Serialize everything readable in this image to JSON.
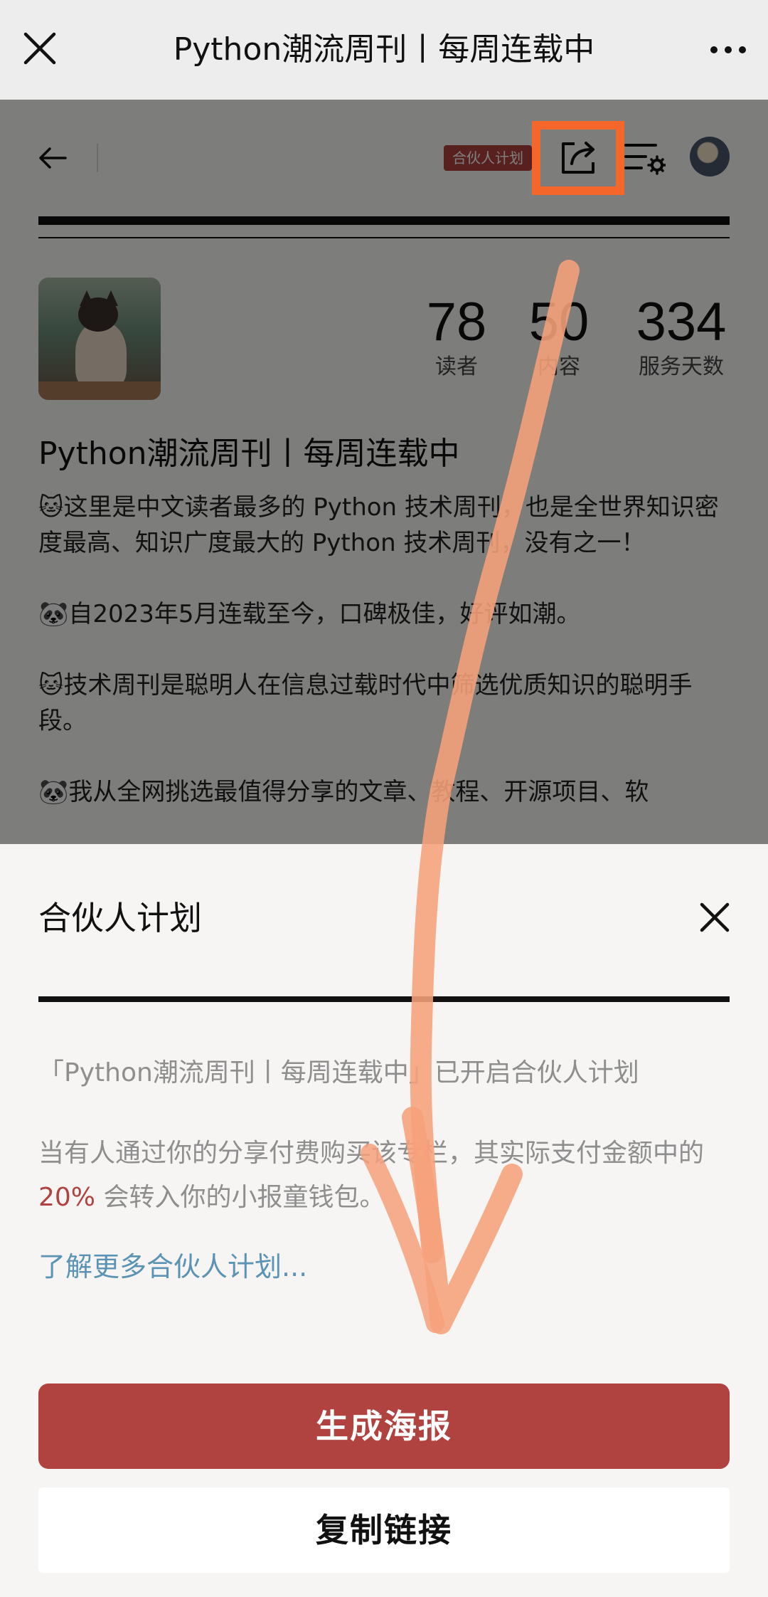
{
  "topbar": {
    "title": "Python潮流周刊丨每周连载中",
    "close_icon": "close-icon",
    "more_icon": "more-icon"
  },
  "header": {
    "partner_tag": "合伙人计划",
    "icons": [
      "back-arrow-icon",
      "share-icon",
      "settings-icon"
    ]
  },
  "column": {
    "title": "Python潮流周刊丨每周连载中",
    "stats": [
      {
        "value": "78",
        "label": "读者"
      },
      {
        "value": "50",
        "label": "内容"
      },
      {
        "value": "334",
        "label": "服务天数"
      }
    ],
    "description": [
      "🐱这里是中文读者最多的 Python 技术周刊，也是全世界知识密度最高、知识广度最大的 Python 技术周刊，没有之一！",
      "🐼自2023年5月连载至今，口碑极佳，好评如潮。",
      "🐱技术周刊是聪明人在信息过载时代中筛选优质知识的聪明手段。",
      "🐼我从全网挑选最值得分享的文章、教程、开源项目、软"
    ]
  },
  "sheet": {
    "title": "合伙人计划",
    "line1": "「Python潮流周刊丨每周连载中」已开启合伙人计划",
    "line2_prefix": "当有人通过你的分享付费购买该专栏，其实际支付金额中的 ",
    "line2_percent": "20%",
    "line2_suffix": " 会转入你的小报童钱包。",
    "learn_more": "了解更多合伙人计划...",
    "primary_button": "生成海报",
    "secondary_button": "复制链接"
  },
  "colors": {
    "accent_red": "#b0423f",
    "highlight_orange": "#f5662a",
    "link_blue": "#5b93b4",
    "arrow_stroke": "#f6a07a"
  }
}
